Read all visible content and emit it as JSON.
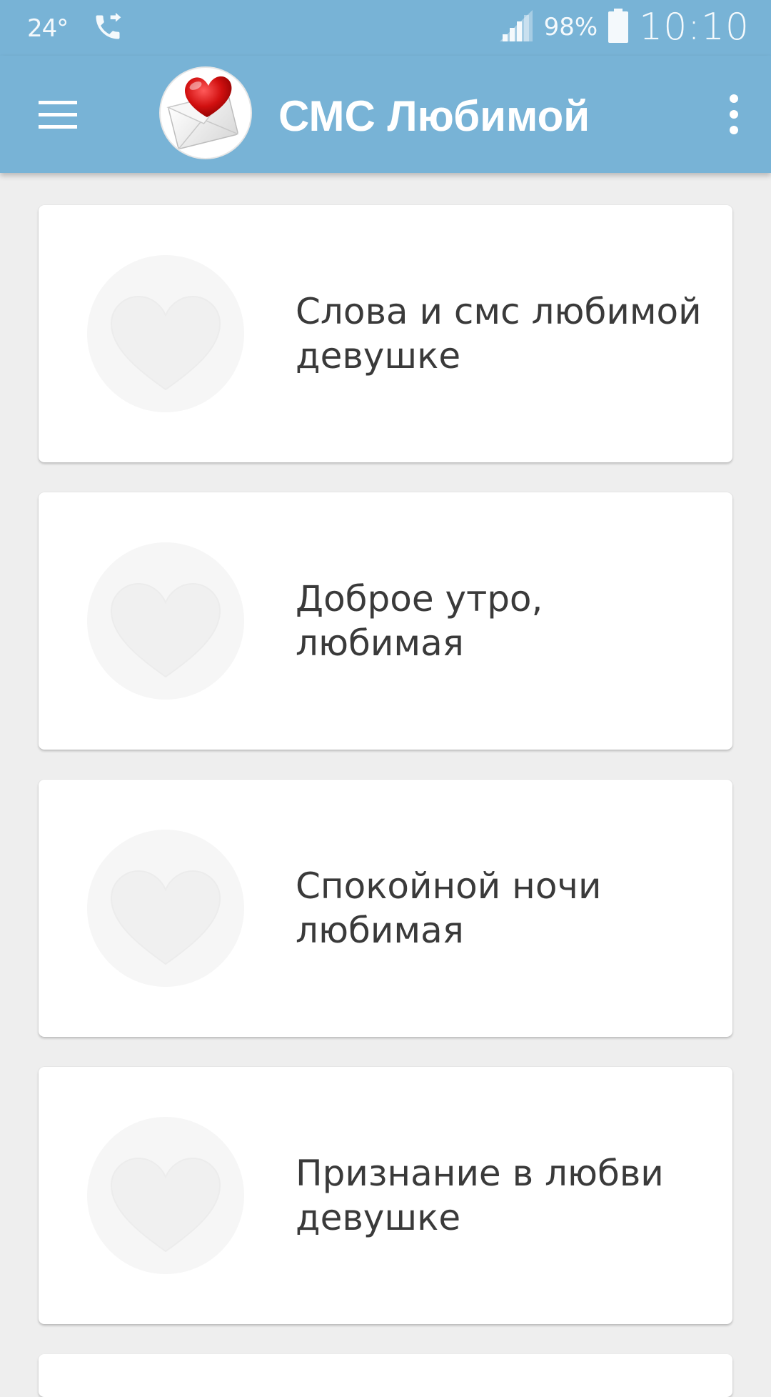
{
  "status_bar": {
    "temperature": "24°",
    "call_forward_icon": "phone-forward-icon",
    "signal_icon": "cell-signal-icon",
    "battery_percent": "98%",
    "battery_icon": "battery-icon",
    "time": "10:10"
  },
  "app_bar": {
    "title": "СМС Любимой",
    "menu_icon": "hamburger-menu-icon",
    "logo_icon": "heart-envelope-logo",
    "overflow_icon": "more-vertical-icon",
    "background_color": "#78b3d6"
  },
  "categories": [
    {
      "label": "Слова и смс любимой девушке",
      "icon": "heart-icon"
    },
    {
      "label": "Доброе утро, любимая",
      "icon": "heart-icon"
    },
    {
      "label": "Спокойной ночи любимая",
      "icon": "heart-icon"
    },
    {
      "label": "Признание в любви девушке",
      "icon": "heart-icon"
    }
  ]
}
